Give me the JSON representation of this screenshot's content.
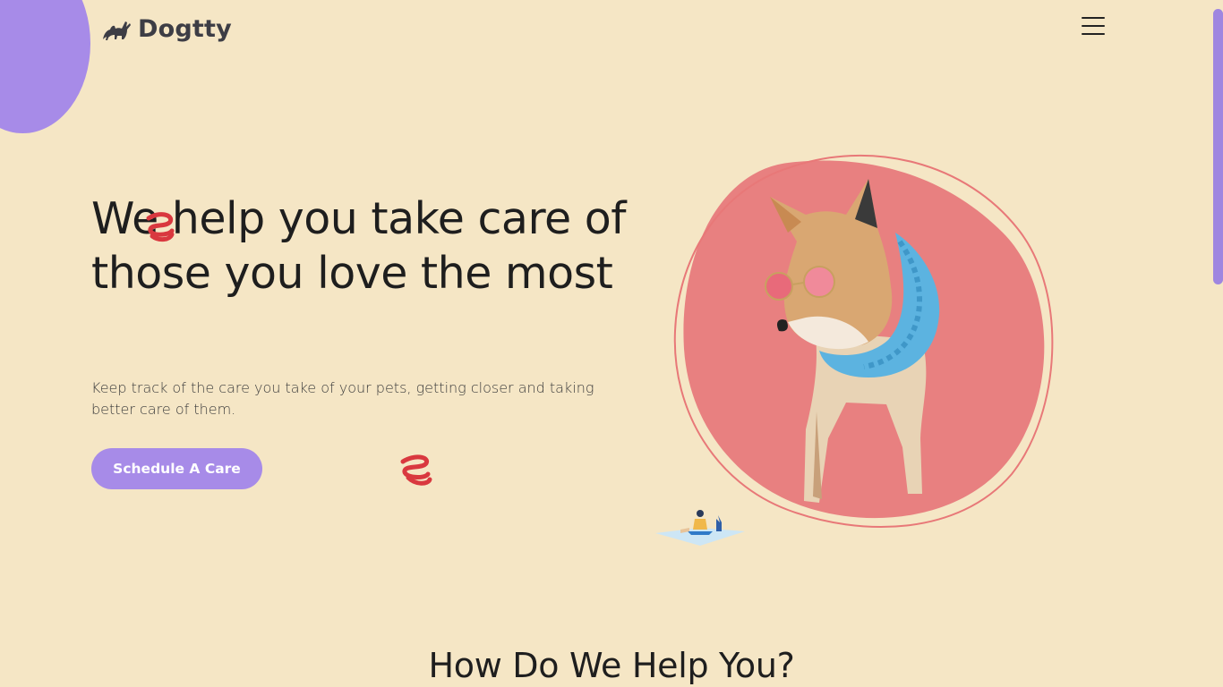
{
  "header": {
    "brand": "Dogtty",
    "logo_icon": "dog-cat-silhouette-icon",
    "menu_icon": "hamburger-menu-icon"
  },
  "hero": {
    "title": "We help you take care of those you love the most",
    "subtitle": "Keep track of the care you take of your pets, getting closer and taking better care of them.",
    "cta_label": "Schedule A Care",
    "image_subject": "dog-in-sunglasses-and-blue-feather-boa",
    "decor": [
      "red-coil-icon",
      "red-coil-icon",
      "yoga-person-illustration"
    ]
  },
  "section": {
    "title": "How Do We Help You?"
  },
  "colors": {
    "background": "#f5e6c5",
    "accent_purple": "#a78be8",
    "blob_pink": "#e88080",
    "text_dark": "#1e1e1e"
  }
}
